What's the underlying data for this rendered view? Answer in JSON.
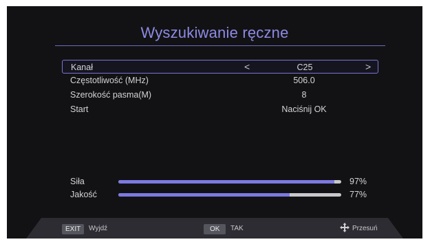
{
  "title": "Wyszukiwanie ręczne",
  "rows": [
    {
      "label": "Kanał",
      "value": "C25"
    },
    {
      "label": "Częstotliwość (MHz)",
      "value": "506.0"
    },
    {
      "label": "Szerokość pasma(M)",
      "value": "8"
    },
    {
      "label": "Start",
      "value": "Naciśnij OK"
    }
  ],
  "arrows": {
    "left": "<",
    "right": ">"
  },
  "signal": [
    {
      "label": "Siła",
      "percent_text": "97%",
      "value": 97
    },
    {
      "label": "Jakość",
      "percent_text": "77%",
      "value": 77
    }
  ],
  "footer": {
    "exit_key": "EXIT",
    "exit_label": "Wyjdź",
    "ok_key": "OK",
    "ok_label": "TAK",
    "move_label": "Przesuń"
  },
  "colors": {
    "accent": "#8e8ae6",
    "bar_fill": "#7c79e0",
    "bar_track": "#c8c8cc",
    "background": "#121214"
  }
}
